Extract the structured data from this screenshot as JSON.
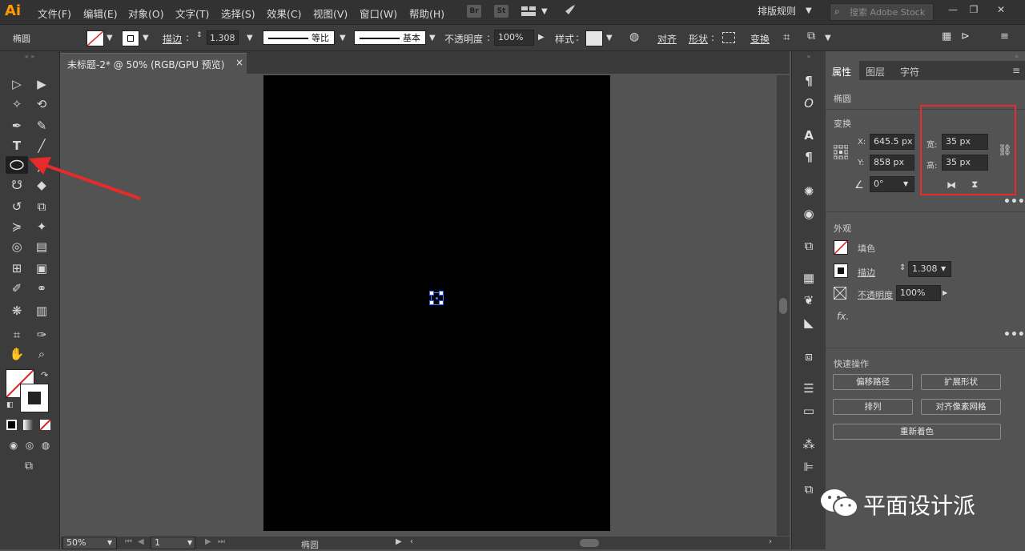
{
  "app": {
    "logo": "Ai"
  },
  "menu": [
    "文件(F)",
    "编辑(E)",
    "对象(O)",
    "文字(T)",
    "选择(S)",
    "效果(C)",
    "视图(V)",
    "窗口(W)",
    "帮助(H)"
  ],
  "menubar_icons": {
    "br": "Br",
    "st": "St"
  },
  "workspace": "排版规则",
  "search": {
    "placeholder": "搜索 Adobe Stock"
  },
  "control": {
    "object_type": "椭圆",
    "stroke_label": "描边",
    "stroke_value": "1.308",
    "profile": "等比",
    "brush": "基本",
    "opacity_label": "不透明度",
    "opacity_value": "100%",
    "style_label": "样式",
    "align": "对齐",
    "shape": "形状",
    "transform": "变换"
  },
  "document": {
    "tab_title": "未标题-2* @ 50% (RGB/GPU 预览)",
    "close": "×"
  },
  "status": {
    "zoom": "50%",
    "page": "1",
    "tool_name": "椭圆"
  },
  "panel": {
    "tabs": [
      "属性",
      "图层",
      "字符"
    ],
    "object_type": "椭圆",
    "transform_title": "变换",
    "x_label": "X:",
    "x_value": "645.5 px",
    "y_label": "Y:",
    "y_value": "858 px",
    "w_label": "宽:",
    "w_value": "35 px",
    "h_label": "高:",
    "h_value": "35 px",
    "angle_value": "0°",
    "appearance_title": "外观",
    "fill_label": "填色",
    "stroke_label": "描边",
    "stroke_value": "1.308",
    "opacity_label": "不透明度",
    "opacity_value": "100%",
    "fx": "fx.",
    "quick_title": "快速操作",
    "quick_buttons": [
      "偏移路径",
      "扩展形状",
      "排列",
      "对齐像素网格",
      "重新着色"
    ]
  },
  "watermark": {
    "text": "平面设计派"
  },
  "colors": {
    "accent_highlight": "#e82a2a",
    "logo": "#ff9a00",
    "selection": "#4d7cff"
  }
}
